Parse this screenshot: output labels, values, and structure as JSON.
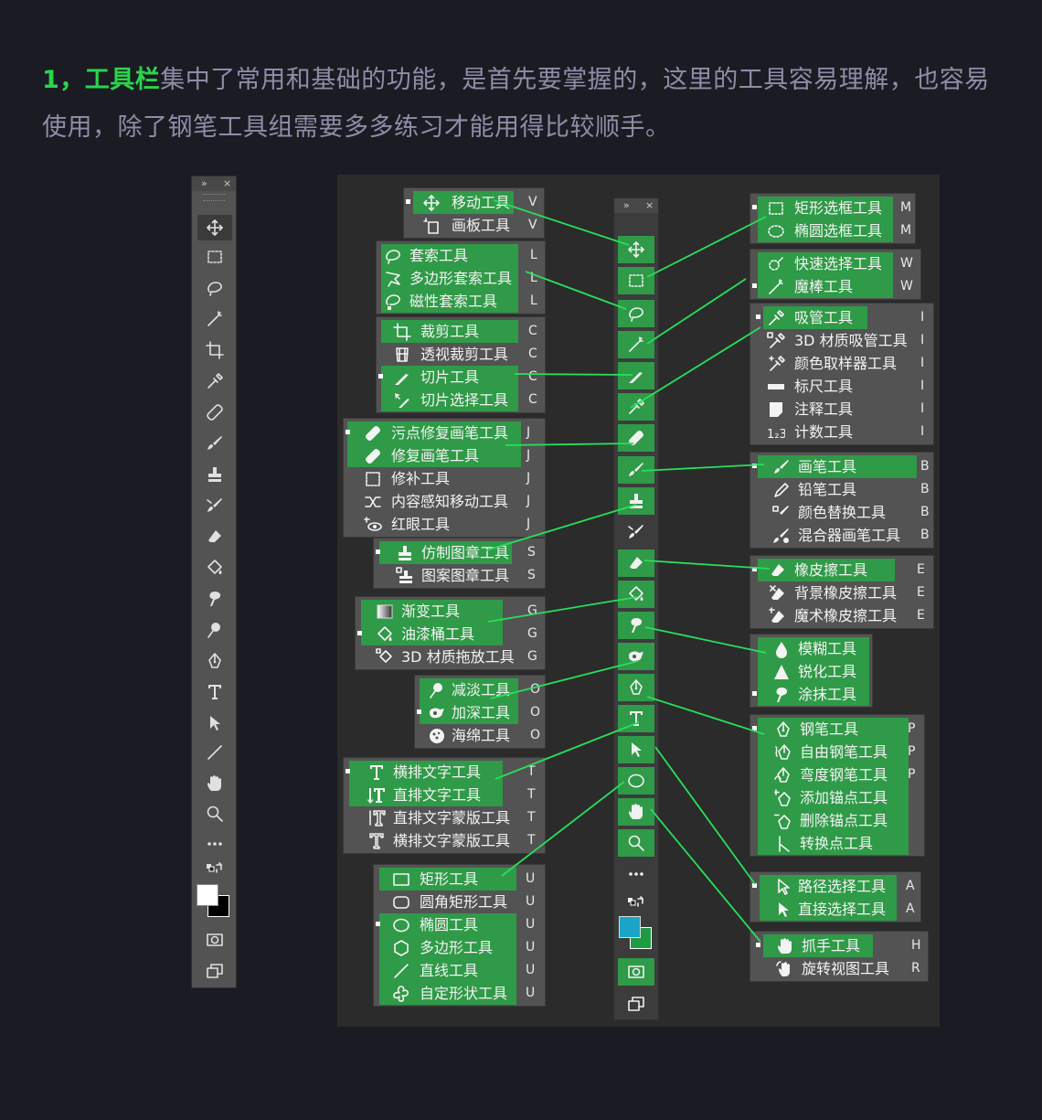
{
  "intro": {
    "highlight": "1，工具栏",
    "rest": "集中了常用和基础的功能，是首先要掌握的，这里的工具容易理解，也容易使用，除了钢笔工具组需要多多练习才能用得比较顺手。"
  },
  "toolbar_header": {
    "expand": "»",
    "close": "×"
  },
  "colors": {
    "accent_green": "#2bd44c",
    "menu_green": "#2f9a47",
    "line_green": "#27e05a",
    "panel": "#535353"
  },
  "left_tools": [
    "move-icon",
    "marquee-icon",
    "lasso-icon",
    "magic-wand-icon",
    "crop-icon",
    "eyedropper-icon",
    "healing-icon",
    "brush-icon",
    "stamp-icon",
    "history-brush-icon",
    "eraser-icon",
    "bucket-icon",
    "smudge-icon",
    "dodge-icon",
    "pen-icon",
    "type-icon",
    "path-select-icon",
    "line-icon",
    "hand-icon",
    "zoom-icon",
    "more-icon",
    "swap-colors-icon",
    "colors-icon",
    "quickmask-icon",
    "screenmode-icon"
  ],
  "menus": [
    {
      "id": "move",
      "items": [
        {
          "label": "移动工具",
          "key": "V",
          "hl": true,
          "dot": true,
          "icon": "move"
        },
        {
          "label": "画板工具",
          "key": "V",
          "hl": false,
          "icon": "artboard"
        }
      ]
    },
    {
      "id": "lasso",
      "items": [
        {
          "label": "套索工具",
          "key": "L",
          "hl": true,
          "icon": "lasso"
        },
        {
          "label": "多边形套索工具",
          "key": "L",
          "hl": true,
          "icon": "polylasso"
        },
        {
          "label": "磁性套索工具",
          "key": "L",
          "hl": true,
          "icon": "maglasso"
        }
      ]
    },
    {
      "id": "crop",
      "items": [
        {
          "label": "裁剪工具",
          "key": "C",
          "hl": true,
          "icon": "crop"
        },
        {
          "label": "透视裁剪工具",
          "key": "C",
          "hl": false,
          "icon": "perspcrop"
        },
        {
          "label": "切片工具",
          "key": "C",
          "hl": true,
          "dot": true,
          "icon": "slice"
        },
        {
          "label": "切片选择工具",
          "key": "C",
          "hl": true,
          "icon": "sliceselect"
        }
      ]
    },
    {
      "id": "heal",
      "items": [
        {
          "label": "污点修复画笔工具",
          "key": "J",
          "hl": true,
          "dot": true,
          "icon": "spotheal"
        },
        {
          "label": "修复画笔工具",
          "key": "J",
          "hl": true,
          "icon": "heal"
        },
        {
          "label": "修补工具",
          "key": "J",
          "hl": false,
          "icon": "patch"
        },
        {
          "label": "内容感知移动工具",
          "key": "J",
          "hl": false,
          "icon": "contentmove"
        },
        {
          "label": "红眼工具",
          "key": "J",
          "hl": false,
          "icon": "redeye"
        }
      ]
    },
    {
      "id": "stamp",
      "items": [
        {
          "label": "仿制图章工具",
          "key": "S",
          "hl": true,
          "dot": true,
          "icon": "stamp"
        },
        {
          "label": "图案图章工具",
          "key": "S",
          "hl": false,
          "icon": "patternstamp"
        }
      ]
    },
    {
      "id": "gradient",
      "items": [
        {
          "label": "渐变工具",
          "key": "G",
          "hl": true,
          "icon": "gradient"
        },
        {
          "label": "油漆桶工具",
          "key": "G",
          "hl": true,
          "dot": true,
          "icon": "bucket"
        },
        {
          "label": "3D 材质拖放工具",
          "key": "G",
          "hl": false,
          "icon": "3ddrop"
        }
      ]
    },
    {
      "id": "dodge",
      "items": [
        {
          "label": "减淡工具",
          "key": "O",
          "hl": true,
          "icon": "dodge"
        },
        {
          "label": "加深工具",
          "key": "O",
          "hl": true,
          "dot": true,
          "icon": "burn"
        },
        {
          "label": "海绵工具",
          "key": "O",
          "hl": false,
          "icon": "sponge"
        }
      ]
    },
    {
      "id": "type",
      "items": [
        {
          "label": "横排文字工具",
          "key": "T",
          "hl": true,
          "dot": true,
          "icon": "htype"
        },
        {
          "label": "直排文字工具",
          "key": "T",
          "hl": true,
          "icon": "vtype"
        },
        {
          "label": "直排文字蒙版工具",
          "key": "T",
          "hl": false,
          "icon": "vtypemask"
        },
        {
          "label": "横排文字蒙版工具",
          "key": "T",
          "hl": false,
          "icon": "htypemask"
        }
      ]
    },
    {
      "id": "shape",
      "items": [
        {
          "label": "矩形工具",
          "key": "U",
          "hl": true,
          "icon": "rect"
        },
        {
          "label": "圆角矩形工具",
          "key": "U",
          "hl": false,
          "icon": "roundrect"
        },
        {
          "label": "椭圆工具",
          "key": "U",
          "hl": true,
          "dot": true,
          "icon": "ellipse"
        },
        {
          "label": "多边形工具",
          "key": "U",
          "hl": true,
          "icon": "polygon"
        },
        {
          "label": "直线工具",
          "key": "U",
          "hl": true,
          "icon": "line"
        },
        {
          "label": "自定形状工具",
          "key": "U",
          "hl": true,
          "icon": "customshape"
        }
      ]
    },
    {
      "id": "marquee",
      "items": [
        {
          "label": "矩形选框工具",
          "key": "M",
          "hl": true,
          "dot": true,
          "icon": "rectmarquee"
        },
        {
          "label": "椭圆选框工具",
          "key": "M",
          "hl": true,
          "icon": "ellmarquee"
        }
      ]
    },
    {
      "id": "quick",
      "items": [
        {
          "label": "快速选择工具",
          "key": "W",
          "hl": true,
          "icon": "quicksel"
        },
        {
          "label": "魔棒工具",
          "key": "W",
          "hl": true,
          "dot": true,
          "icon": "wand"
        }
      ]
    },
    {
      "id": "eyedrop",
      "items": [
        {
          "label": "吸管工具",
          "key": "I",
          "hl": true,
          "dot": true,
          "icon": "eyedropper"
        },
        {
          "label": "3D 材质吸管工具",
          "key": "I",
          "hl": false,
          "icon": "3deyedrop"
        },
        {
          "label": "颜色取样器工具",
          "key": "I",
          "hl": false,
          "icon": "colorsampler"
        },
        {
          "label": "标尺工具",
          "key": "I",
          "hl": false,
          "icon": "ruler"
        },
        {
          "label": "注释工具",
          "key": "I",
          "hl": false,
          "icon": "note"
        },
        {
          "label": "计数工具",
          "key": "I",
          "hl": false,
          "icon": "count"
        }
      ]
    },
    {
      "id": "brush",
      "items": [
        {
          "label": "画笔工具",
          "key": "B",
          "hl": true,
          "dot": true,
          "icon": "brush"
        },
        {
          "label": "铅笔工具",
          "key": "B",
          "hl": false,
          "icon": "pencil"
        },
        {
          "label": "颜色替换工具",
          "key": "B",
          "hl": false,
          "icon": "colorreplace"
        },
        {
          "label": "混合器画笔工具",
          "key": "B",
          "hl": false,
          "icon": "mixer"
        }
      ]
    },
    {
      "id": "eraser",
      "items": [
        {
          "label": "橡皮擦工具",
          "key": "E",
          "hl": true,
          "dot": true,
          "icon": "eraser"
        },
        {
          "label": "背景橡皮擦工具",
          "key": "E",
          "hl": false,
          "icon": "bgeraser"
        },
        {
          "label": "魔术橡皮擦工具",
          "key": "E",
          "hl": false,
          "icon": "magiceraser"
        }
      ]
    },
    {
      "id": "blur",
      "items": [
        {
          "label": "模糊工具",
          "key": "",
          "hl": true,
          "icon": "blur"
        },
        {
          "label": "锐化工具",
          "key": "",
          "hl": true,
          "icon": "sharpen"
        },
        {
          "label": "涂抹工具",
          "key": "",
          "hl": true,
          "dot": true,
          "icon": "smudge"
        }
      ]
    },
    {
      "id": "pen",
      "items": [
        {
          "label": "钢笔工具",
          "key": "P",
          "hl": true,
          "dot": true,
          "icon": "pen"
        },
        {
          "label": "自由钢笔工具",
          "key": "P",
          "hl": true,
          "icon": "freepen"
        },
        {
          "label": "弯度钢笔工具",
          "key": "P",
          "hl": true,
          "icon": "curvepen"
        },
        {
          "label": "添加锚点工具",
          "key": "",
          "hl": true,
          "icon": "addanchor"
        },
        {
          "label": "删除锚点工具",
          "key": "",
          "hl": true,
          "icon": "delanchor"
        },
        {
          "label": "转换点工具",
          "key": "",
          "hl": true,
          "icon": "convert"
        }
      ]
    },
    {
      "id": "pathsel",
      "items": [
        {
          "label": "路径选择工具",
          "key": "A",
          "hl": true,
          "dot": true,
          "icon": "pathsel"
        },
        {
          "label": "直接选择工具",
          "key": "A",
          "hl": true,
          "icon": "directsel"
        }
      ]
    },
    {
      "id": "hand",
      "items": [
        {
          "label": "抓手工具",
          "key": "H",
          "hl": true,
          "dot": true,
          "icon": "hand"
        },
        {
          "label": "旋转视图工具",
          "key": "R",
          "hl": false,
          "icon": "rotateview"
        }
      ]
    }
  ]
}
